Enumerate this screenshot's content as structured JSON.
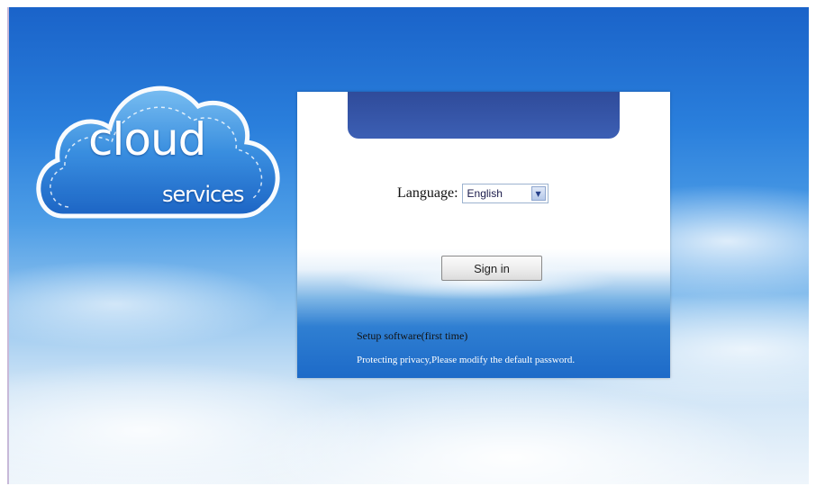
{
  "logo": {
    "cloud_text": "cloud",
    "services_text": "services"
  },
  "login": {
    "language_label": "Language:",
    "language_selected": "English",
    "signin_label": "Sign in",
    "setup_link": "Setup software(first time)",
    "privacy_text": "Protecting privacy,Please modify the default password."
  },
  "colors": {
    "sky_top": "#1a63c9",
    "panel_tab": "#2f4b9a",
    "panel_bottom": "#1d6ac8"
  },
  "icons": {
    "logo": "cloud-logo-icon",
    "dropdown": "chevron-down-icon"
  }
}
